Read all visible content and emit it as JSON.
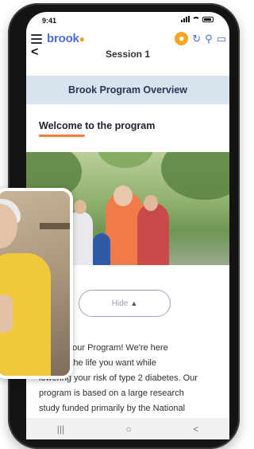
{
  "status_bar": {
    "time": "9:41"
  },
  "app": {
    "logo": "brook",
    "logo_mark": "●",
    "back_icon": "chevron-left-icon",
    "session_title": "Session 1",
    "actions": {
      "coin_icon": "coin-icon",
      "refresh_icon": "refresh-icon",
      "profile_icon": "person-icon",
      "chat_icon": "chat-icon"
    }
  },
  "content": {
    "overview_title": "Brook Program Overview",
    "welcome_heading": "Welcome to the program",
    "hide_label": "Hide",
    "body_lines": [
      "come to our Program! We're here",
      "you live the life you want while",
      "lowering your risk of type 2 diabetes. Our",
      "program is based on a large research",
      "study funded primarily by the National"
    ]
  },
  "colors": {
    "accent": "#4a6cd8",
    "orange": "#f47d3a",
    "banner": "#d9e2ef"
  }
}
